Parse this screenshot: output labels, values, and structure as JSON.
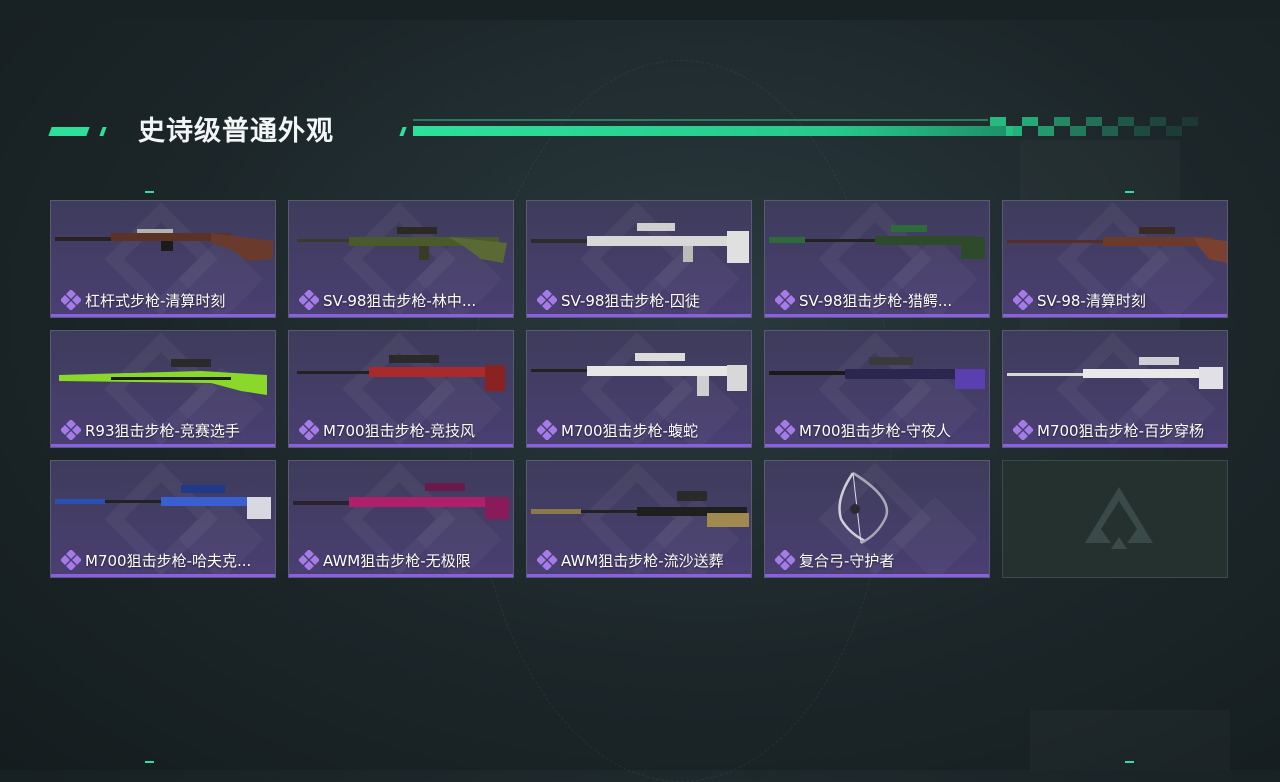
{
  "section": {
    "title": "史诗级普通外观"
  },
  "colors": {
    "accent": "#2ee09a",
    "rarity": "#8a5fe0",
    "card_bg": "#463f69"
  },
  "items": [
    {
      "label": "杠杆式步枪-清算时刻",
      "icon": "lever-rifle-icon"
    },
    {
      "label": "SV-98狙击步枪-林中...",
      "icon": "sniper-rifle-icon"
    },
    {
      "label": "SV-98狙击步枪-囚徒",
      "icon": "sniper-rifle-icon"
    },
    {
      "label": "SV-98狙击步枪-猎鳄...",
      "icon": "sniper-rifle-icon"
    },
    {
      "label": "SV-98-清算时刻",
      "icon": "sniper-rifle-icon"
    },
    {
      "label": "R93狙击步枪-竞赛选手",
      "icon": "sniper-rifle-icon"
    },
    {
      "label": "M700狙击步枪-竞技风",
      "icon": "sniper-rifle-icon"
    },
    {
      "label": "M700狙击步枪-蝮蛇",
      "icon": "sniper-rifle-icon"
    },
    {
      "label": "M700狙击步枪-守夜人",
      "icon": "sniper-rifle-icon"
    },
    {
      "label": "M700狙击步枪-百步穿杨",
      "icon": "sniper-rifle-icon"
    },
    {
      "label": "M700狙击步枪-哈夫克...",
      "icon": "sniper-rifle-icon"
    },
    {
      "label": "AWM狙击步枪-无极限",
      "icon": "sniper-rifle-icon"
    },
    {
      "label": "AWM狙击步枪-流沙送葬",
      "icon": "sniper-rifle-icon"
    },
    {
      "label": "复合弓-守护者",
      "icon": "compound-bow-icon"
    }
  ],
  "empty_slot": {
    "icon": "faction-logo-icon"
  }
}
